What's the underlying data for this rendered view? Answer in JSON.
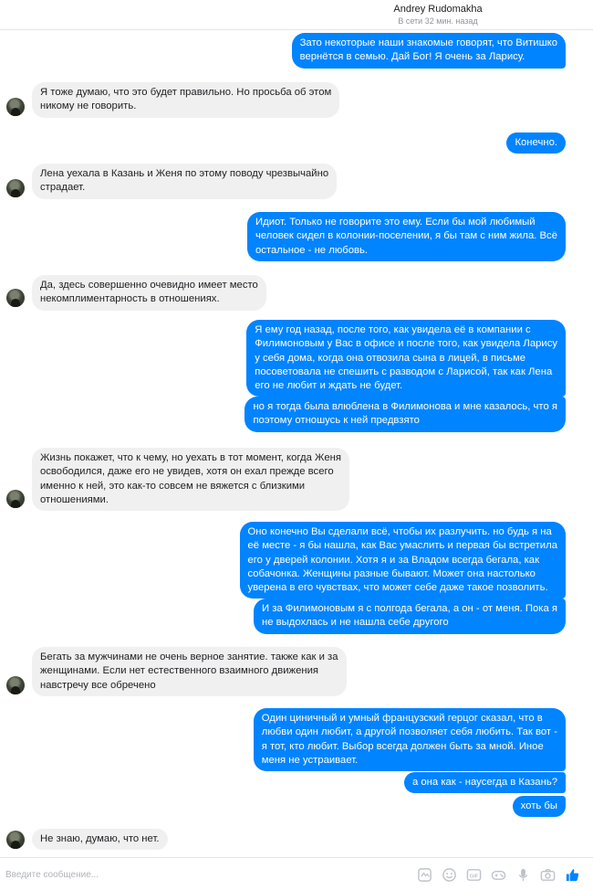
{
  "header": {
    "contact_name": "Andrey Rudomakha",
    "status": "В сети 32 мин. назад"
  },
  "messages": [
    {
      "side": "out",
      "text": "Зато некоторые наши знакомые говорят, что Витишко\nвернётся в семью. Дай Бог! Я очень за Ларису."
    },
    {
      "side": "in",
      "text": "Я тоже думаю, что это будет правильно. Но просьба об этом\nникому не говорить."
    },
    {
      "side": "out",
      "text": "Конечно."
    },
    {
      "side": "in",
      "text": "Лена уехала в Казань и Женя по этому поводу чрезвычайно\nстрадает."
    },
    {
      "side": "out",
      "text": "Идиот. Только не говорите это ему. Если бы мой любимый\nчеловек сидел в колонии-поселении, я бы там с ним жила. Всё\nостальное - не любовь."
    },
    {
      "side": "in",
      "text": "Да, здесь совершенно очевидно имеет место\nнекомплиментарность в отношениях."
    },
    {
      "side": "out",
      "text": "Я ему год назад, после того, как увидела её в компании с\nФилимоновым у Вас в офисе и после того, как увидела Ларису\nу себя дома, когда она отвозила сына в лицей, в письме\nпосоветовала не спешить с разводом с Ларисой, так как Лена\nего не любит и ждать не будет."
    },
    {
      "side": "out",
      "text": "но я тогда была влюблена в Филимонова и мне казалось, что я\nпоэтому отношусь к ней предвзято"
    },
    {
      "side": "in",
      "text": "Жизнь покажет, что к чему, но уехать в тот момент, когда Женя\nосвободился, даже его не увидев, хотя он ехал прежде всего\nименно к ней, это как-то совсем не вяжется с близкими\nотношениями."
    },
    {
      "side": "out",
      "text": "Оно конечно Вы сделали всё, чтобы их разлучить. но будь я на\nеё месте - я бы нашла, как Вас умаслить и первая бы встретила\nего у дверей колонии. Хотя я и за Владом всегда бегала, как\nсобачонка. Женщины разные бывают. Может она настолько\nуверена в его чувствах, что может себе даже такое позволить."
    },
    {
      "side": "out",
      "text": "И за Филимоновым я с полгода бегала, а он - от меня. Пока я\nне выдохлась и не нашла себе другого"
    },
    {
      "side": "in",
      "text": "Бегать за мужчинами не очень верное занятие. также как и за\nженщинами. Если нет естественного взаимного движения\nнавстречу все обречено"
    },
    {
      "side": "out",
      "text": "Один циничный и умный французский герцог сказал, что в\nлюбви один любит, а другой позволяет себя любить. Так вот -\nя тот, кто любит. Выбор всегда должен быть за мной. Иное\nменя не устраивает."
    },
    {
      "side": "out",
      "text": "а она как - наусегда в Казань?"
    },
    {
      "side": "out",
      "text": "хоть бы"
    },
    {
      "side": "in",
      "text": "Не знаю, думаю, что нет."
    }
  ],
  "composer": {
    "placeholder": "Введите сообщение..."
  },
  "toolbar_icons": [
    "sticker-pack-icon",
    "emoji-icon",
    "gif-icon",
    "game-icon",
    "mic-icon",
    "camera-icon",
    "like-icon"
  ],
  "colors": {
    "outgoing": "#0084ff",
    "incoming": "#f1f0f0",
    "accent": "#0084ff"
  }
}
